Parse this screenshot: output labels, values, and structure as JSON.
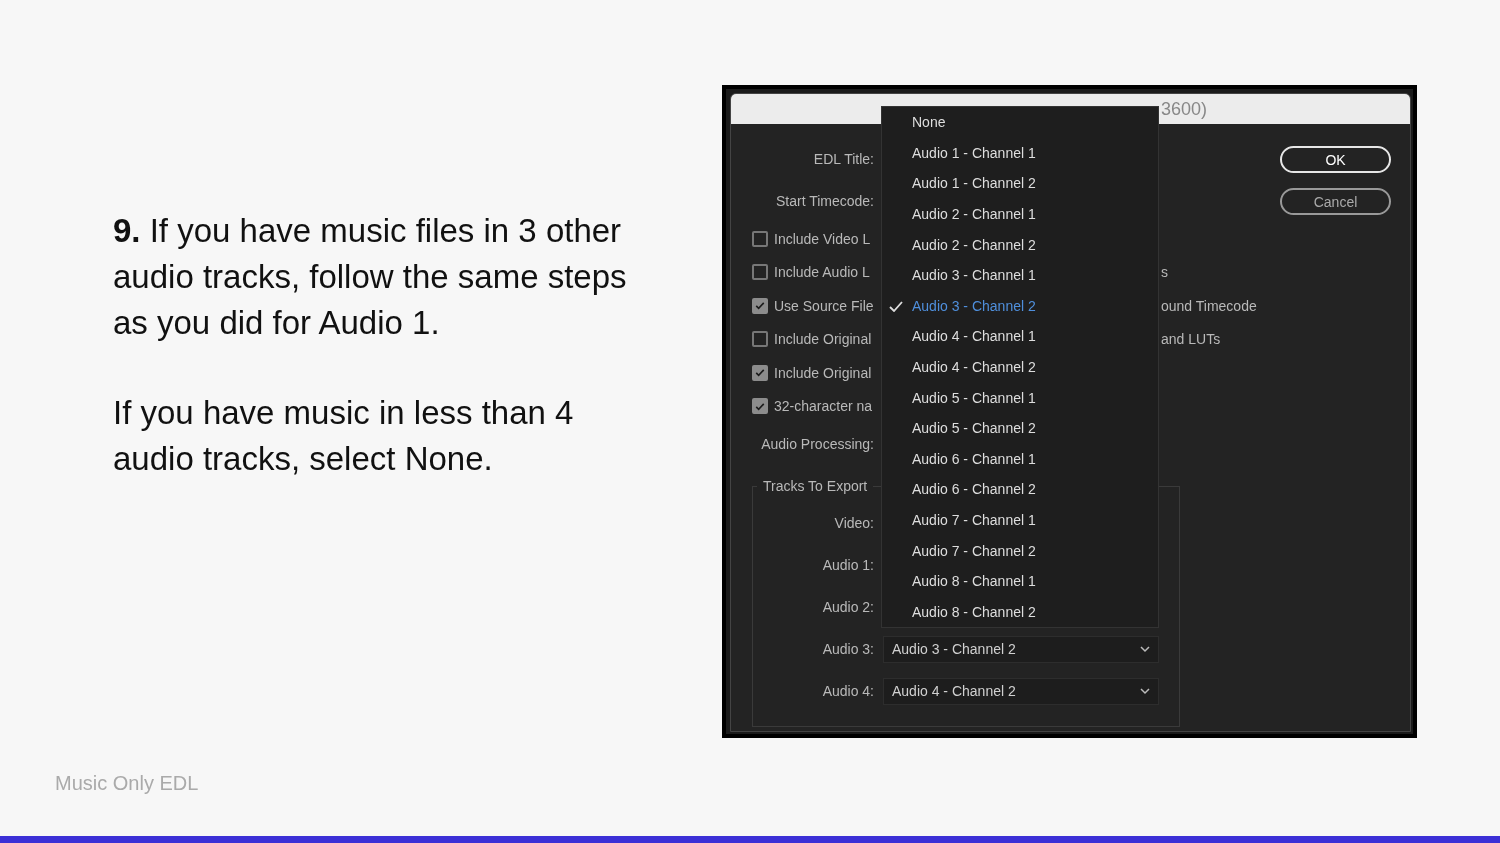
{
  "slide": {
    "paragraphs": [
      "**9.** If you have music files in 3 other audio tracks, follow the same steps as you did for Audio 1.",
      "If you have music in less than 4 audio tracks, select None."
    ],
    "footer": "Music Only EDL"
  },
  "dialog": {
    "title": "3600)",
    "fields": [
      {
        "kind": "label",
        "label": "EDL Title:"
      },
      {
        "kind": "label",
        "label": "Start Timecode:"
      },
      {
        "kind": "checkbox",
        "label": "Include Video L",
        "checked": false
      },
      {
        "kind": "checkbox",
        "label": "Include Audio L",
        "checked": false,
        "trailing": "s"
      },
      {
        "kind": "checkbox",
        "label": "Use Source File",
        "checked": true,
        "trailing": "ound Timecode"
      },
      {
        "kind": "checkbox",
        "label": "Include Original",
        "checked": false,
        "trailing": "and LUTs"
      },
      {
        "kind": "checkbox",
        "label": "Include Original",
        "checked": true
      },
      {
        "kind": "checkbox",
        "label": "32-character na",
        "checked": true
      },
      {
        "kind": "label",
        "label": "Audio Processing:"
      }
    ],
    "tracks": {
      "legend": "Tracks To Export",
      "rows": [
        {
          "label": "Video:"
        },
        {
          "label": "Audio 1:"
        },
        {
          "label": "Audio 2:"
        },
        {
          "label": "Audio 3:",
          "value": "Audio 3 - Channel 2"
        },
        {
          "label": "Audio 4:",
          "value": "Audio 4 - Channel 2"
        }
      ]
    },
    "buttons": [
      {
        "label": "OK",
        "default": true
      },
      {
        "label": "Cancel",
        "default": false
      }
    ],
    "menu": {
      "items": [
        {
          "label": "None",
          "selected": false
        },
        {
          "label": "Audio 1 - Channel 1",
          "selected": false
        },
        {
          "label": "Audio 1 - Channel 2",
          "selected": false
        },
        {
          "label": "Audio 2 - Channel 1",
          "selected": false
        },
        {
          "label": "Audio 2 - Channel 2",
          "selected": false
        },
        {
          "label": "Audio 3 - Channel 1",
          "selected": false
        },
        {
          "label": "Audio 3 - Channel 2",
          "selected": true
        },
        {
          "label": "Audio 4 - Channel 1",
          "selected": false
        },
        {
          "label": "Audio 4 - Channel 2",
          "selected": false
        },
        {
          "label": "Audio 5 - Channel 1",
          "selected": false
        },
        {
          "label": "Audio 5 - Channel 2",
          "selected": false
        },
        {
          "label": "Audio 6 - Channel 1",
          "selected": false
        },
        {
          "label": "Audio 6 - Channel 2",
          "selected": false
        },
        {
          "label": "Audio 7 - Channel 1",
          "selected": false
        },
        {
          "label": "Audio 7 - Channel 2",
          "selected": false
        },
        {
          "label": "Audio 8 - Channel 1",
          "selected": false
        },
        {
          "label": "Audio 8 - Channel 2",
          "selected": false
        }
      ]
    }
  }
}
